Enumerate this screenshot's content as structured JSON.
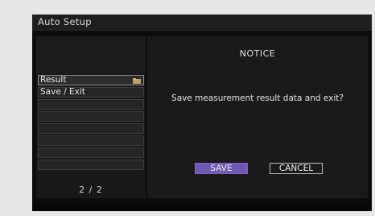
{
  "window": {
    "title": "Auto Setup"
  },
  "menu": {
    "items": [
      {
        "label": "Result",
        "icon": "folder-icon"
      },
      {
        "label": "Save / Exit"
      },
      {
        "label": ""
      },
      {
        "label": ""
      },
      {
        "label": ""
      },
      {
        "label": ""
      },
      {
        "label": ""
      },
      {
        "label": ""
      }
    ],
    "selected_index": 0,
    "page_indicator": "2 / 2"
  },
  "dialog": {
    "title": "NOTICE",
    "message": "Save measurement result data and exit?",
    "save_label": "SAVE",
    "cancel_label": "CANCEL"
  },
  "colors": {
    "save_button": "#6e58b3",
    "background": "#0c0c0c",
    "frame": "#e7e7e7"
  }
}
